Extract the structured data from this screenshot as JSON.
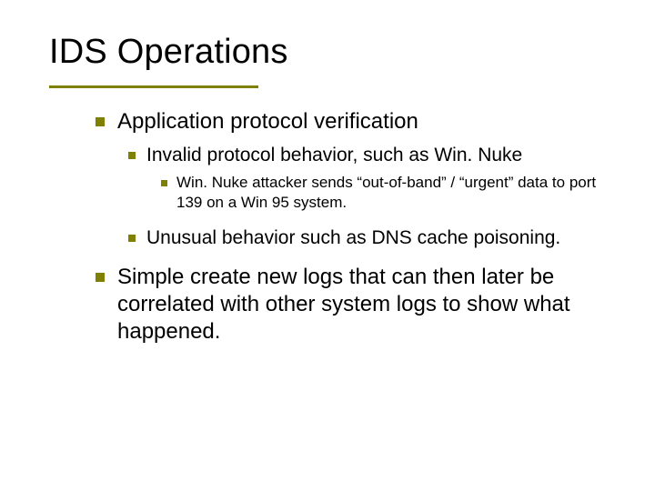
{
  "title": "IDS Operations",
  "colors": {
    "accent": "#808000"
  },
  "bullets": {
    "l1a": "Application protocol verification",
    "l2a": "Invalid protocol behavior, such as Win. Nuke",
    "l3a": "Win. Nuke attacker sends “out-of-band” / “urgent” data to port 139 on a Win 95 system.",
    "l2b": "Unusual behavior such as DNS cache poisoning.",
    "l1b": "Simple create new logs that can then later be correlated with other system logs to show what happened."
  }
}
